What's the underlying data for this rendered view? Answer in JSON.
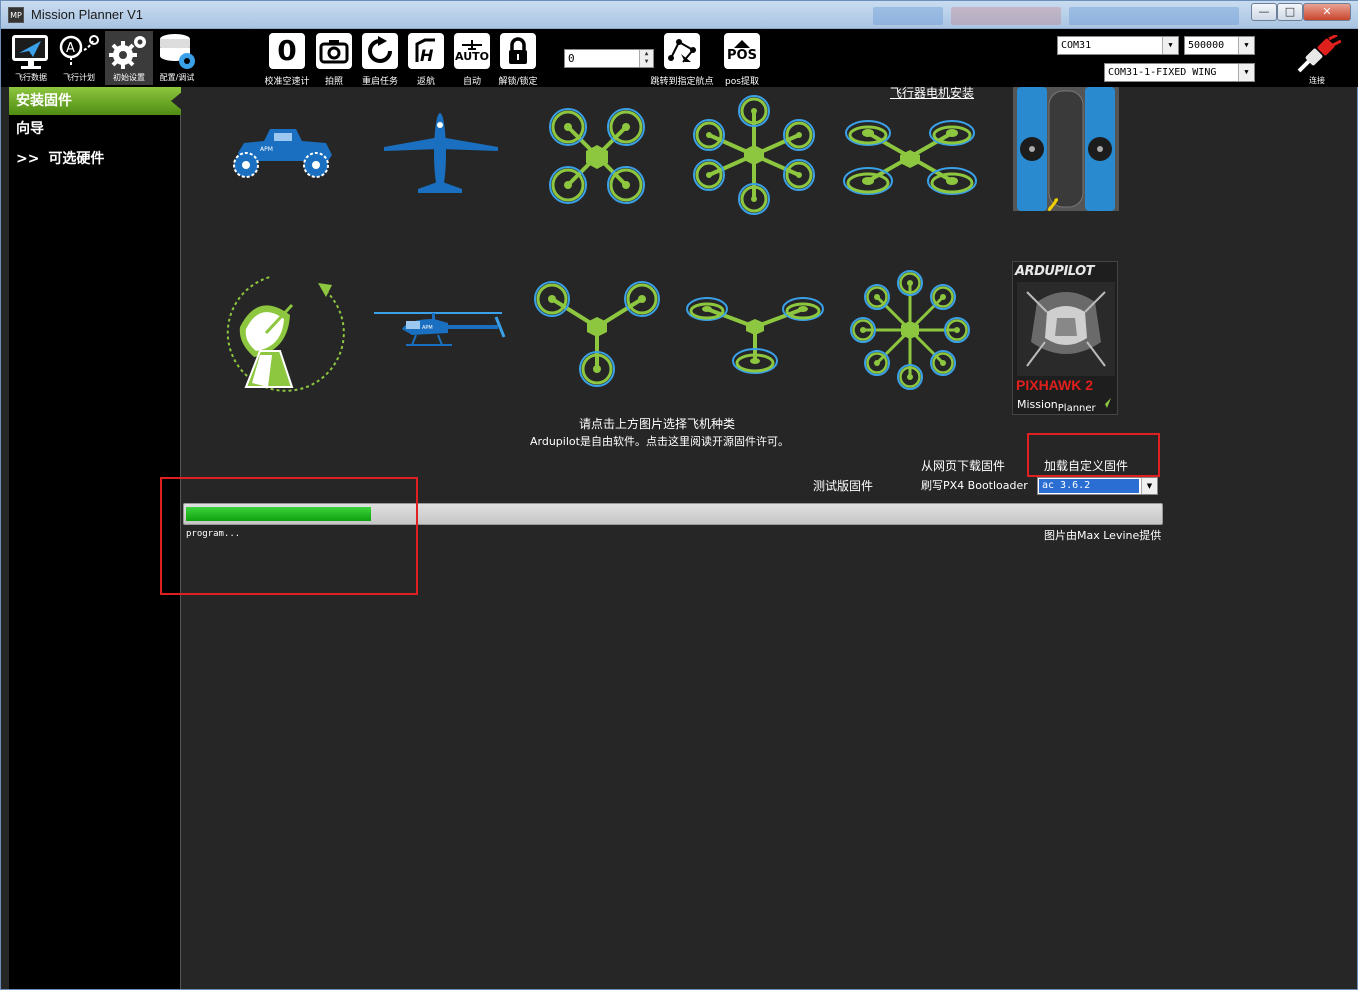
{
  "window": {
    "title": "Mission Planner V1",
    "app_icon_text": "MP",
    "controls": [
      "minimize",
      "maximize",
      "close"
    ]
  },
  "nav": [
    {
      "label": "飞行数据",
      "icon": "flight-data-icon"
    },
    {
      "label": "飞行计划",
      "icon": "flight-plan-icon"
    },
    {
      "label": "初始设置",
      "icon": "initial-setup-icon",
      "active": true
    },
    {
      "label": "配置/调试",
      "icon": "config-tuning-icon"
    }
  ],
  "actions": [
    {
      "label": "校准空速计",
      "icon_text": "0"
    },
    {
      "label": "拍照",
      "icon": "camera-icon"
    },
    {
      "label": "重启任务",
      "icon": "restart-icon"
    },
    {
      "label": "返航",
      "icon": "return-home-icon"
    },
    {
      "label": "自动",
      "icon_text": "AUTO"
    },
    {
      "label": "解锁/锁定",
      "icon": "lock-icon"
    }
  ],
  "waypoint": {
    "value": "0",
    "label": "跳转到指定航点"
  },
  "pos": {
    "label": "pos提取",
    "icon_text": "POS"
  },
  "connection": {
    "port": "COM31",
    "baud": "500000",
    "profile": "COM31-1-FIXED WING",
    "connect_label": "连接"
  },
  "sidebar": [
    {
      "label": "安装固件",
      "active": true
    },
    {
      "label": "向导"
    },
    {
      "label": "可选硬件",
      "chevron": ">>"
    }
  ],
  "content": {
    "motor_link": "飞行器电机安装",
    "vehicles": [
      "rover",
      "plane",
      "quad",
      "hexa",
      "octa-quad",
      "coax-stand",
      "antenna-tracker",
      "heli",
      "tri",
      "y6",
      "octa",
      "pixhawk2"
    ],
    "pixhawk_card": {
      "brand": "ARDUPILOT",
      "model": "PIXHAWK 2",
      "footer_a": "Mission",
      "footer_b": "Planner"
    },
    "instruction": "请点击上方图片选择飞机种类",
    "license_text": "Ardupilot是自由软件。点击这里阅读开源固件许可。",
    "download_web": "从网页下载固件",
    "load_custom": "加载自定义固件",
    "beta_firmware": "测试版固件",
    "flash_bootloader": "刷写PX4 Bootloader",
    "firmware_version": "ac 3.6.2",
    "progress": 0.19,
    "status": "program...",
    "credit": "图片由Max Levine提供"
  },
  "colors": {
    "accent_green": "#8dc63f",
    "prop_blue": "#3aa0e8",
    "vehicle_blue": "#1a6fc0",
    "progress_green": "#19b319",
    "highlight_red": "#e02020"
  }
}
